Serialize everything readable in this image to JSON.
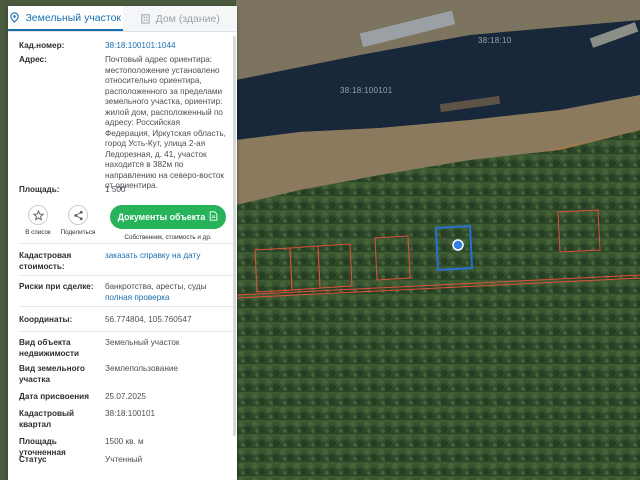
{
  "tabs": [
    {
      "label": "Земельный участок",
      "icon": "pin-icon",
      "active": true
    },
    {
      "label": "Дом (здание)",
      "icon": "building-icon",
      "active": false
    }
  ],
  "fields": {
    "cadastral_number": {
      "label": "Кад.номер:",
      "value": "38:18:100101:1044"
    },
    "address": {
      "label": "Адрес:",
      "value": "Почтовый адрес ориентира: местоположение установлено относительно ориентира, расположенного за пределами земельного участка, ориентир: жилой дом, расположенный по адресу: Российская Федерация, Иркутская область, город Усть-Кут, улица 2-ая Ледорезная, д. 41, участок находится в 382м по направлению на северо-восток от ориентира."
    },
    "area": {
      "label": "Площадь:",
      "value": "1 500"
    },
    "cadastral_value": {
      "label": "Кадастровая стоимость:",
      "link": "заказать справку на дату"
    },
    "risks": {
      "label": "Риски при сделке:",
      "value": "банкротства, аресты, суды",
      "link": "полная проверка"
    },
    "coordinates": {
      "label": "Координаты:",
      "value": "56.774804, 105.760547"
    },
    "object_type": {
      "label": "Вид объекта недвижимости",
      "value": "Земельный участок"
    },
    "land_type": {
      "label": "Вид земельного участка",
      "value": "Землепользование"
    },
    "assign_date": {
      "label": "Дата присвоения",
      "value": "25.07.2025"
    },
    "quarter": {
      "label": "Кадастровый квартал",
      "value": "38:18:100101"
    },
    "area_precise": {
      "label": "Площадь уточненная",
      "value": "1500 кв. м"
    },
    "status": {
      "label": "Статус",
      "value": "Учтенный"
    }
  },
  "actions": {
    "favorite_label": "В список",
    "share_label": "Поделиться",
    "docs_label": "Документы объекта",
    "docs_sub": "Собственник, стоимость и др."
  },
  "map": {
    "labels": [
      "38:18:10",
      "38:18:100101"
    ],
    "colors": {
      "parcel": "#e0503a",
      "selected": "#2a6fd6",
      "marker": "#2f7fe0",
      "water": "#18273a",
      "forest": "#2b4628"
    }
  }
}
